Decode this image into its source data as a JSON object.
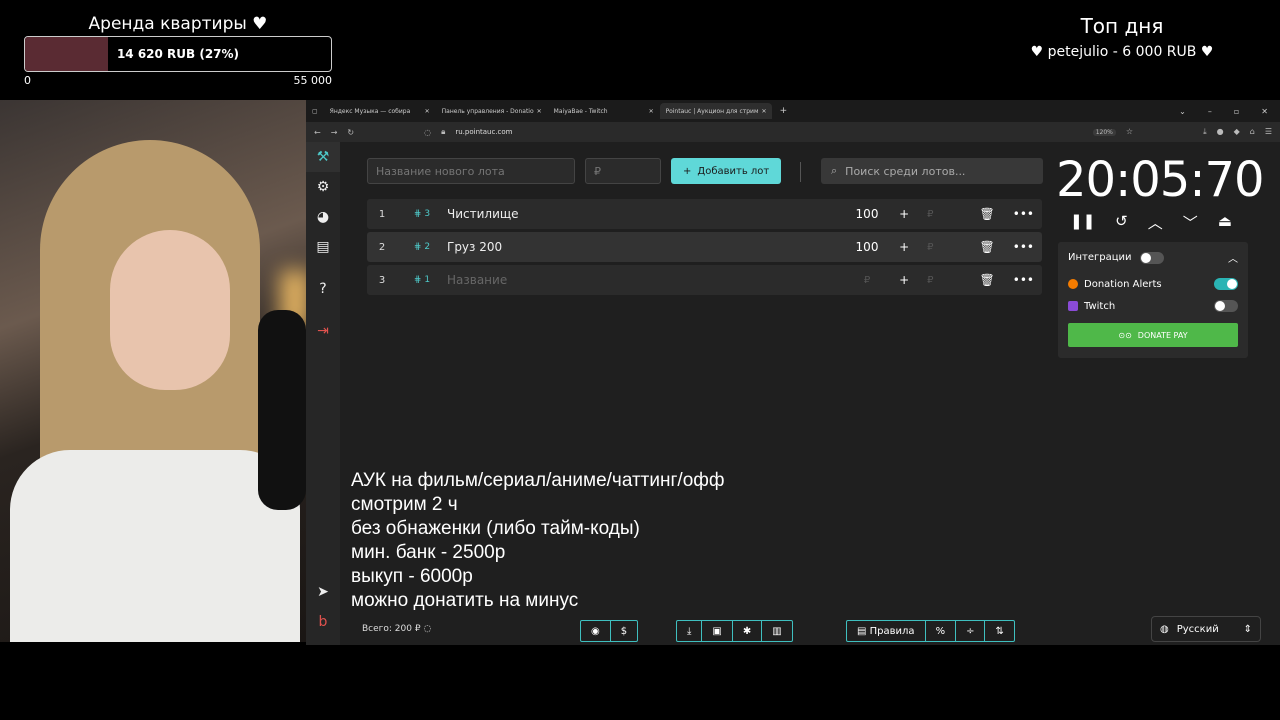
{
  "overlay": {
    "goal": {
      "title": "Аренда квартиры",
      "text": "14 620 RUB (27%)",
      "progress": 0.27,
      "min": "0",
      "max": "55 000"
    },
    "top_day": {
      "title": "Топ дня",
      "entry": "petejulio - 6 000 RUB"
    }
  },
  "browser": {
    "tabs": [
      {
        "label": "Яндекс Музыка — собира",
        "active": false
      },
      {
        "label": "Панель управления - Donatio",
        "active": false
      },
      {
        "label": "MaiyaBae - Twitch",
        "active": false
      },
      {
        "label": "Pointauc | Аукцион для стрим",
        "active": true
      }
    ],
    "url": "ru.pointauc.com",
    "zoom": "120%"
  },
  "app": {
    "new_lot_placeholder": "Название нового лота",
    "amount_placeholder": "₽",
    "add_button": "Добавить лот",
    "search_placeholder": "Поиск среди лотов...",
    "lots": [
      {
        "num": "1",
        "id": "3",
        "name": "Чистилище",
        "amount": "100"
      },
      {
        "num": "2",
        "id": "2",
        "name": "Груз 200",
        "amount": "100"
      },
      {
        "num": "3",
        "id": "1",
        "name": "Название",
        "amount": ""
      }
    ],
    "currency": "₽",
    "timer": "20:05:70",
    "integrations": {
      "title": "Интеграции",
      "donation_alerts": "Donation Alerts",
      "twitch": "Twitch",
      "donate_pay": "DONATE PAY"
    },
    "promo_lines": [
      "АУК на фильм/сериал/аниме/чаттинг/офф",
      "смотрим 2 ч",
      "без обнаженки (либо тайм-коды)",
      "мин. банк - 2500р",
      "выкуп - 6000р",
      "можно донатить на минус"
    ],
    "footer": {
      "total": "Всего: 200 ₽",
      "rules": "Правила",
      "language": "Русский"
    }
  },
  "colors": {
    "accent": "#5fd8d8",
    "danger": "#e0524e",
    "donate_pay": "#4fb849",
    "goal_fill": "#5a2b33"
  }
}
